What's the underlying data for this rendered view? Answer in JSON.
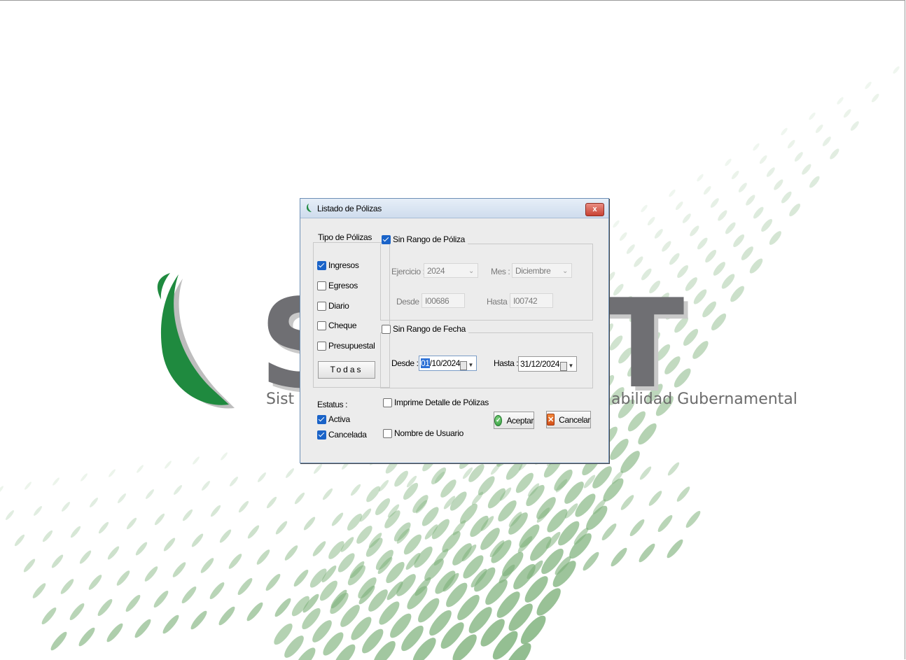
{
  "background": {
    "brand_text": "SI   NET",
    "subtitle_left": "Sist",
    "subtitle_right": "abilidad Gubernamental",
    "accent_green": "#1f8a3f",
    "dot_green": "#7fb27c"
  },
  "dialog": {
    "title": "Listado de Pólizas",
    "close_label": "x",
    "tipo_polizas": {
      "legend": "Tipo de Pólizas",
      "items": [
        {
          "label": "Ingresos",
          "checked": true
        },
        {
          "label": "Egresos",
          "checked": false
        },
        {
          "label": "Diario",
          "checked": false
        },
        {
          "label": "Cheque",
          "checked": false
        },
        {
          "label": "Presupuestal",
          "checked": false
        }
      ],
      "todas_label": "Todas"
    },
    "estatus": {
      "label": "Estatus :",
      "items": [
        {
          "label": "Activa",
          "checked": true
        },
        {
          "label": "Cancelada",
          "checked": true
        }
      ]
    },
    "sin_rango_poliza": {
      "label": "Sin Rango de Póliza",
      "checked": true,
      "ejercicio_label": "Ejercicio :",
      "ejercicio_value": "2024",
      "mes_label": "Mes :",
      "mes_value": "Diciembre",
      "desde_label": "Desde :",
      "desde_value": "I00686",
      "hasta_label": "Hasta :",
      "hasta_value": "I00742"
    },
    "sin_rango_fecha": {
      "label": "Sin Rango de Fecha",
      "checked": false,
      "desde_label": "Desde :",
      "desde_sel": "01",
      "desde_rest": "/10/2024",
      "hasta_label": "Hasta :",
      "hasta_value": "31/12/2024"
    },
    "imprime_detalle": {
      "label": "Imprime Detalle de Pólizas",
      "checked": false
    },
    "nombre_usuario": {
      "label": "Nombre de Usuario",
      "checked": false
    },
    "aceptar_label": "Aceptar",
    "cancelar_label": "Cancelar"
  }
}
